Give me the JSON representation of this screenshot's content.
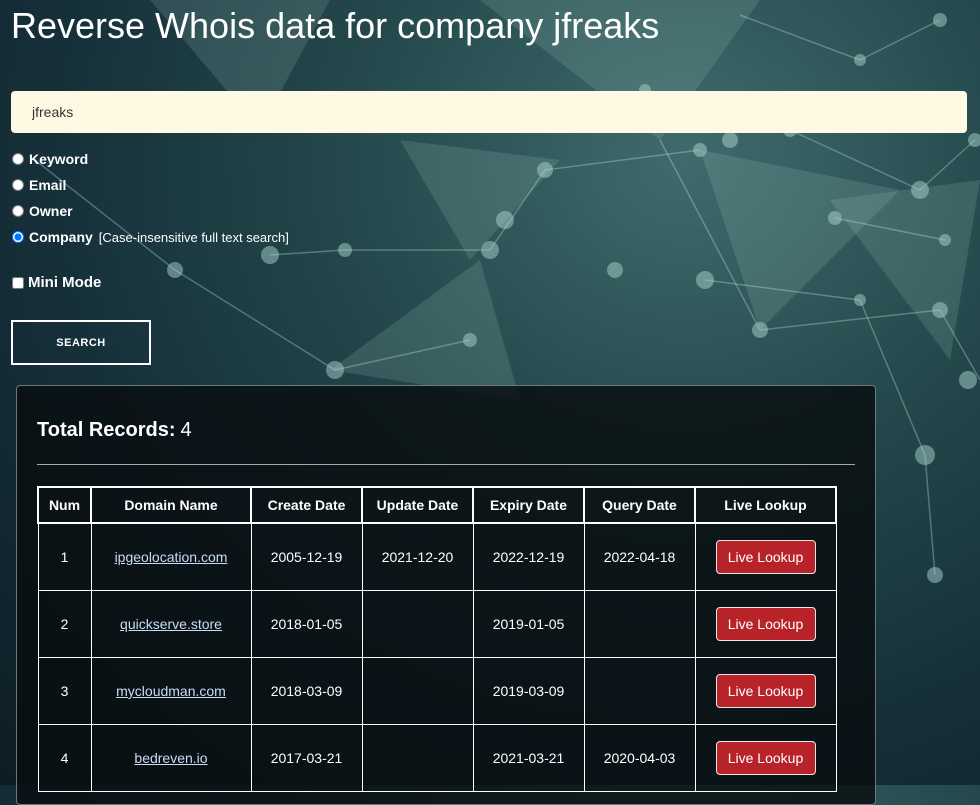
{
  "page": {
    "title": "Reverse Whois data for company jfreaks"
  },
  "search": {
    "value": "jfreaks",
    "options": [
      {
        "label": "Keyword",
        "hint": "",
        "checked": false
      },
      {
        "label": "Email",
        "hint": "",
        "checked": false
      },
      {
        "label": "Owner",
        "hint": "",
        "checked": false
      },
      {
        "label": "Company",
        "hint": "[Case-insensitive full text search]",
        "checked": true
      }
    ],
    "mini_mode_label": "Mini Mode",
    "button_label": "SEARCH"
  },
  "results": {
    "total_label": "Total Records:",
    "total_value": "4",
    "columns": [
      "Num",
      "Domain Name",
      "Create Date",
      "Update Date",
      "Expiry Date",
      "Query Date",
      "Live Lookup"
    ],
    "rows": [
      {
        "num": "1",
        "domain": "ipgeolocation.com",
        "create": "2005-12-19",
        "update": "2021-12-20",
        "expiry": "2022-12-19",
        "query": "2022-04-18",
        "action": "Live Lookup"
      },
      {
        "num": "2",
        "domain": "quickserve.store",
        "create": "2018-01-05",
        "update": "",
        "expiry": "2019-01-05",
        "query": "",
        "action": "Live Lookup"
      },
      {
        "num": "3",
        "domain": "mycloudman.com",
        "create": "2018-03-09",
        "update": "",
        "expiry": "2019-03-09",
        "query": "",
        "action": "Live Lookup"
      },
      {
        "num": "4",
        "domain": "bedreven.io",
        "create": "2017-03-21",
        "update": "",
        "expiry": "2021-03-21",
        "query": "2020-04-03",
        "action": "Live Lookup"
      }
    ]
  },
  "colors": {
    "input_bg": "#fef9e2",
    "lookup_button": "#b8232a",
    "link": "#c9dcf5"
  }
}
